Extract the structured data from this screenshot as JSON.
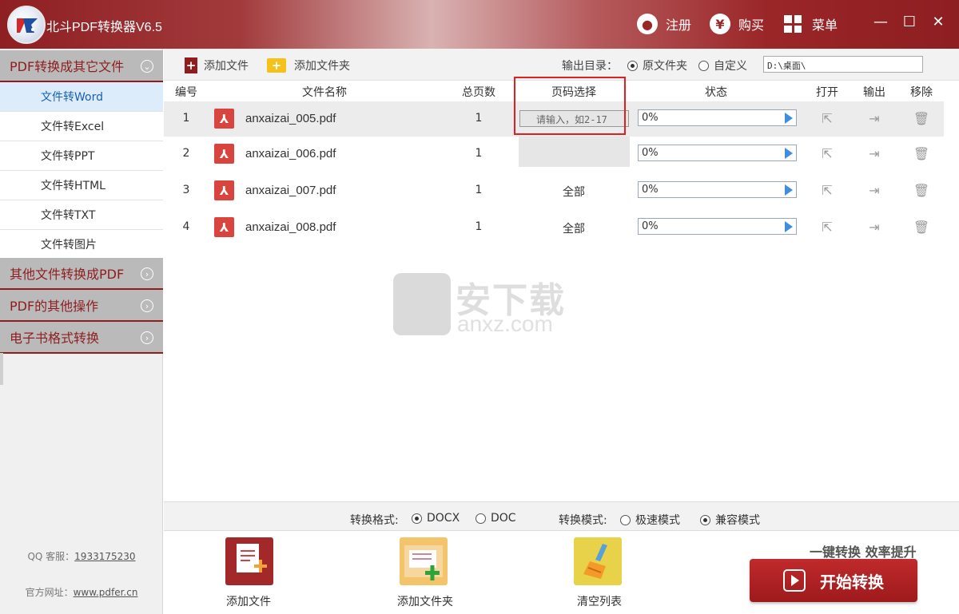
{
  "app": {
    "title": "北斗PDF转换器V6.5",
    "register": "注册",
    "buy": "购买",
    "menu": "菜单",
    "win_min": "—",
    "win_max": "☐",
    "win_close": "✕"
  },
  "sidebar": {
    "categories": [
      {
        "label": "PDF转换成其它文件"
      },
      {
        "label": "其他文件转换成PDF"
      },
      {
        "label": "PDF的其他操作"
      },
      {
        "label": "电子书格式转换"
      }
    ],
    "items": [
      {
        "label": "文件转Word"
      },
      {
        "label": "文件转Excel"
      },
      {
        "label": "文件转PPT"
      },
      {
        "label": "文件转HTML"
      },
      {
        "label": "文件转TXT"
      },
      {
        "label": "文件转图片"
      }
    ],
    "qq_label": "QQ 客服：",
    "qq_value": "1933175230",
    "site_label": "官方网址：",
    "site_value": "www.pdfer.cn"
  },
  "toolbar": {
    "add_file": "添加文件",
    "add_folder": "添加文件夹",
    "output_dir": "输出目录：",
    "opt_source": "原文件夹",
    "opt_custom": "自定义",
    "path": "D:\\桌面\\"
  },
  "table": {
    "headers": {
      "num": "编号",
      "name": "文件名称",
      "pages": "总页数",
      "range": "页码选择",
      "status": "状态",
      "open": "打开",
      "output": "输出",
      "remove": "移除"
    },
    "range_placeholder": "请输入，如2-17",
    "rows": [
      {
        "num": "1",
        "name": "anxaizai_005.pdf",
        "pages": "1",
        "range": "",
        "status": "0%"
      },
      {
        "num": "2",
        "name": "anxaizai_006.pdf",
        "pages": "1",
        "range": "",
        "status": "0%"
      },
      {
        "num": "3",
        "name": "anxaizai_007.pdf",
        "pages": "1",
        "range": "全部",
        "status": "0%"
      },
      {
        "num": "4",
        "name": "anxaizai_008.pdf",
        "pages": "1",
        "range": "全部",
        "status": "0%"
      }
    ]
  },
  "watermark": {
    "text": "安下载",
    "sub": "anxz.com"
  },
  "format": {
    "format_label": "转换格式:",
    "docx": "DOCX",
    "doc": "DOC",
    "mode_label": "转换模式:",
    "fast": "极速模式",
    "compat": "兼容模式"
  },
  "bottom": {
    "add_file": "添加文件",
    "add_folder": "添加文件夹",
    "clear": "清空列表",
    "slogan": "一键转换  效率提升",
    "start": "开始转换"
  },
  "colors": {
    "brand": "#8f1d1f",
    "accent_blue": "#3d8ee0",
    "highlight": "#e02020"
  }
}
